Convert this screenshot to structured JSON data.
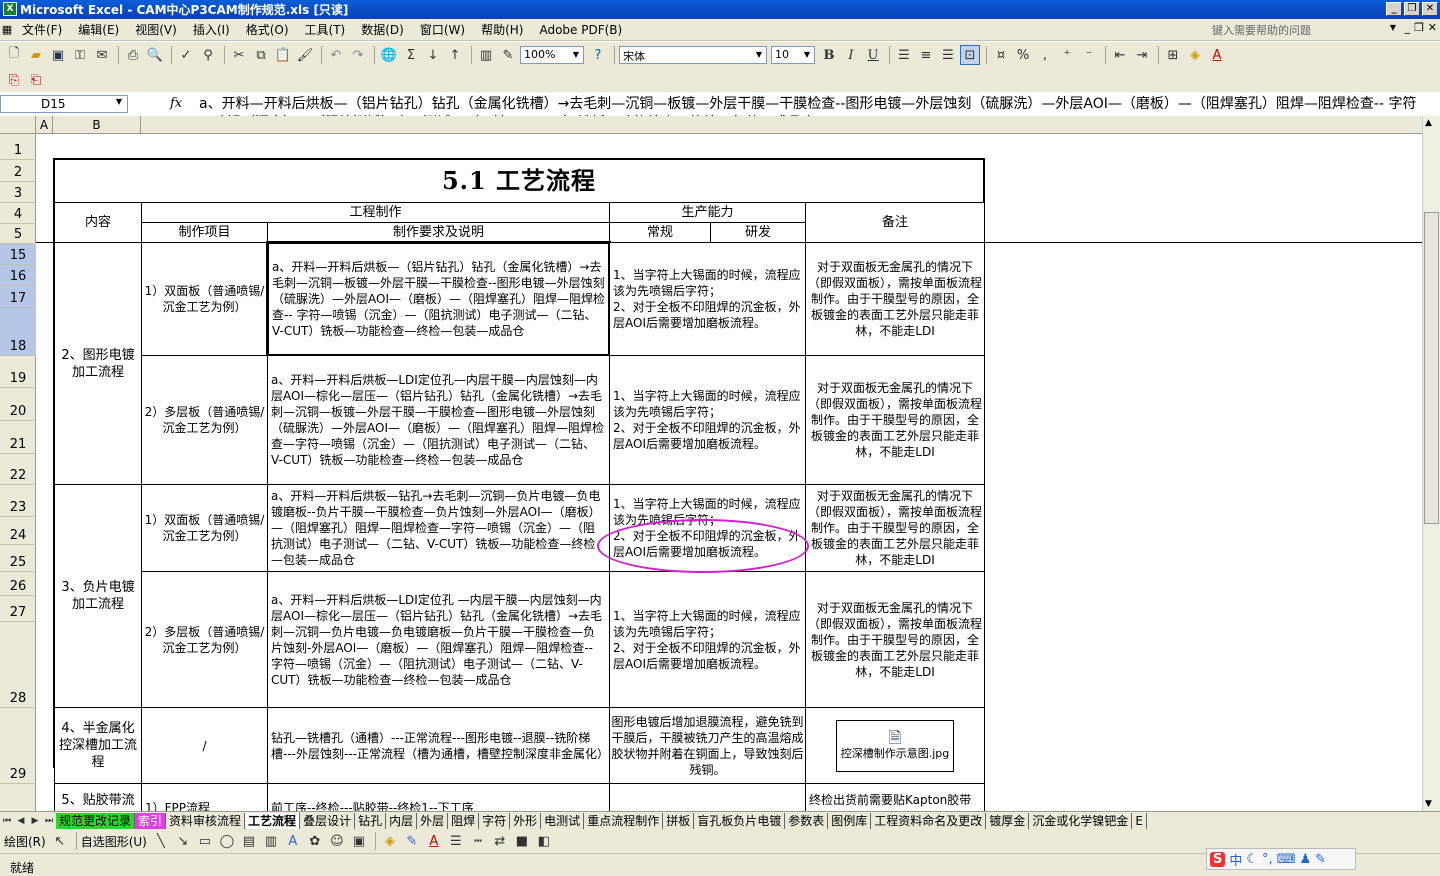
{
  "window": {
    "title": "Microsoft Excel - CAM中心P3CAM制作规范.xls [只读]",
    "minimize": "_",
    "restore": "❐",
    "close": "✕",
    "app_icon": "X"
  },
  "menu": {
    "items": [
      "文件(F)",
      "编辑(E)",
      "视图(V)",
      "插入(I)",
      "格式(O)",
      "工具(T)",
      "数据(D)",
      "窗口(W)",
      "帮助(H)",
      "Adobe PDF(B)"
    ],
    "help_placeholder": "键入需要帮助的问题"
  },
  "toolbar": {
    "zoom": "100%",
    "font": "宋体",
    "font_size": "10",
    "bold": "B",
    "italic": "I",
    "underline": "U",
    "percent": "%",
    "comma": ","
  },
  "formula_bar": {
    "name_box": "D15",
    "fx": "fx",
    "content": "a、开料—开料后烘板—（铝片钻孔）钻孔（金属化铣槽）→去毛刺—沉铜—板镀—外层干膜—干膜检查--图形电镀—外层蚀刻（硫脲洗）—外层AOI—（磨板）—（阻焊塞孔）阻焊—阻焊检查-- 字符—喷锡（沉金）—（阻抗测试）电子测试—（二钻、V-CUT）铣板—功能检查—终检—包装—成品仓"
  },
  "columns": [
    "A",
    "B"
  ],
  "rows": [
    "1",
    "2",
    "3",
    "4",
    "5",
    "15",
    "16",
    "17",
    "18",
    "19",
    "20",
    "21",
    "22",
    "23",
    "24",
    "25",
    "26",
    "27",
    "28",
    "29"
  ],
  "sheet": {
    "title": "5.1 工艺流程",
    "headers": {
      "content": "内容",
      "engineering": "工程制作",
      "item": "制作项目",
      "requirement": "制作要求及说明",
      "capacity": "生产能力",
      "regular": "常规",
      "rd": "研发",
      "remark": "备注"
    },
    "groups": {
      "pattern_plating": "2、图形电镀加工流程",
      "negative_plating": "3、负片电镀加工流程",
      "half_metal": "4、半金属化控深槽加工流程",
      "tape_partial": "5、贴胶带流"
    },
    "rows": [
      {
        "item": "1）双面板（普通喷锡/沉金工艺为例）",
        "requirement": "a、开料—开料后烘板—（铝片钻孔）钻孔（金属化铣槽）→去毛刺—沉铜—板镀—外层干膜—干膜检查--图形电镀—外层蚀刻（硫脲洗）—外层AOI—（磨板）—（阻焊塞孔）阻焊—阻焊检查-- 字符—喷锡（沉金）—（阻抗测试）电子测试—（二钻、V-CUT）铣板—功能检查—终检—包装—成品仓",
        "capacity": "1、当字符上大锡面的时候，流程应该为先喷锡后字符；\n2、对于全板不印阻焊的沉金板，外层AOI后需要增加磨板流程。",
        "remark": "对于双面板无金属孔的情况下（即假双面板），需按单面板流程制作。由于干膜型号的原因，全板镀金的表面工艺外层只能走菲林，不能走LDI"
      },
      {
        "item": "2）多层板（普通喷锡/沉金工艺为例）",
        "requirement": "a、开料—开料后烘板—LDI定位孔—内层干膜—内层蚀刻—内层AOI—棕化—层压—（铝片钻孔）钻孔（金属化铣槽）→去毛刺—沉铜—板镀—外层干膜—干膜检查—图形电镀—外层蚀刻（硫脲洗）—外层AOI—（磨板）—（阻焊塞孔）阻焊—阻焊检查—字符—喷锡（沉金）—（阻抗测试）电子测试—（二钻、V-CUT）铣板—功能检查—终检—包装—成品仓",
        "capacity": "1、当字符上大锡面的时候，流程应该为先喷锡后字符；\n2、对于全板不印阻焊的沉金板，外层AOI后需要增加磨板流程。",
        "remark": "对于双面板无金属孔的情况下（即假双面板），需按单面板流程制作。由于干膜型号的原因，全板镀金的表面工艺外层只能走菲林，不能走LDI"
      },
      {
        "item": "1）双面板（普通喷锡/沉金工艺为例）",
        "requirement": "a、开料—开料后烘板—钻孔→去毛刺—沉铜—负片电镀—负电镀磨板--负片干膜—干膜检查—负片蚀刻—外层AOI—（磨板）—（阻焊塞孔）阻焊—阻焊检查—字符—喷锡（沉金）—（阻抗测试）电子测试—（二钻、V-CUT）铣板—功能检查—终检—包装—成品仓",
        "capacity": "1、当字符上大锡面的时候，流程应该为先喷锡后字符；\n2、对于全板不印阻焊的沉金板，外层AOI后需要增加磨板流程。",
        "remark": "对于双面板无金属孔的情况下（即假双面板），需按单面板流程制作。由于干膜型号的原因，全板镀金的表面工艺外层只能走菲林，不能走LDI"
      },
      {
        "item": "2）多层板（普通喷锡/沉金工艺为例）",
        "requirement": "a、开料—开料后烘板—LDI定位孔 —内层干膜—内层蚀刻—内层AOI—棕化—层压—（铝片钻孔）钻孔（金属化铣槽）→去毛刺—沉铜—负片电镀—负电镀磨板—负片干膜—干膜检查—负片蚀刻-外层AOI—（磨板）—（阻焊塞孔）阻焊—阻焊检查-- 字符—喷锡（沉金）—（阻抗测试）电子测试—（二钻、V-CUT）铣板—功能检查—终检—包装—成品仓",
        "capacity": "1、当字符上大锡面的时候，流程应该为先喷锡后字符；\n2、对于全板不印阻焊的沉金板，外层AOI后需要增加磨板流程。",
        "remark": "对于双面板无金属孔的情况下（即假双面板），需按单面板流程制作。由于干膜型号的原因，全板镀金的表面工艺外层只能走菲林，不能走LDI"
      },
      {
        "item": "/",
        "requirement": "钻孔—铣槽孔（通槽）---正常流程---图形电镀--退膜--铣阶梯槽---外层蚀刻---正常流程（槽为通槽，槽壁控制深度非金属化）",
        "capacity": "图形电镀后增加退膜流程，避免铣到干膜后，干膜被铣刀产生的高温熔成胶状物并附着在铜面上，导致蚀刻后残铜。",
        "remark": "控深槽制作示意图.jpg"
      },
      {
        "item": "1）FPP流程",
        "requirement": "前工序--终检---贴胶带--终检1--下工序",
        "capacity": "",
        "remark": "终检出货前需要贴Kapton胶带"
      }
    ]
  },
  "tabs": [
    "规范更改记录",
    "索引",
    "资料审核流程",
    "工艺流程",
    "叠层设计",
    "钻孔",
    "内层",
    "外层",
    "阻焊",
    "字符",
    "外形",
    "电测试",
    "重点流程制作",
    "拼板",
    "盲孔板负片电镀",
    "参数表",
    "图例库",
    "工程资料命名及更改",
    "镀厚金",
    "沉金或化学镍钯金",
    "E"
  ],
  "drawbar": {
    "draw": "绘图(R)",
    "autoshape": "自选图形(U)"
  },
  "status": {
    "text": "就绪",
    "ime_label": "中"
  },
  "colors": {
    "title_bar": "#0a50c8",
    "ui_face": "#ece9d8",
    "tab_green": "#2bd62b",
    "tab_magenta": "#e040e0",
    "annotation": "#d020d0",
    "selection": "#b6c6e6"
  }
}
